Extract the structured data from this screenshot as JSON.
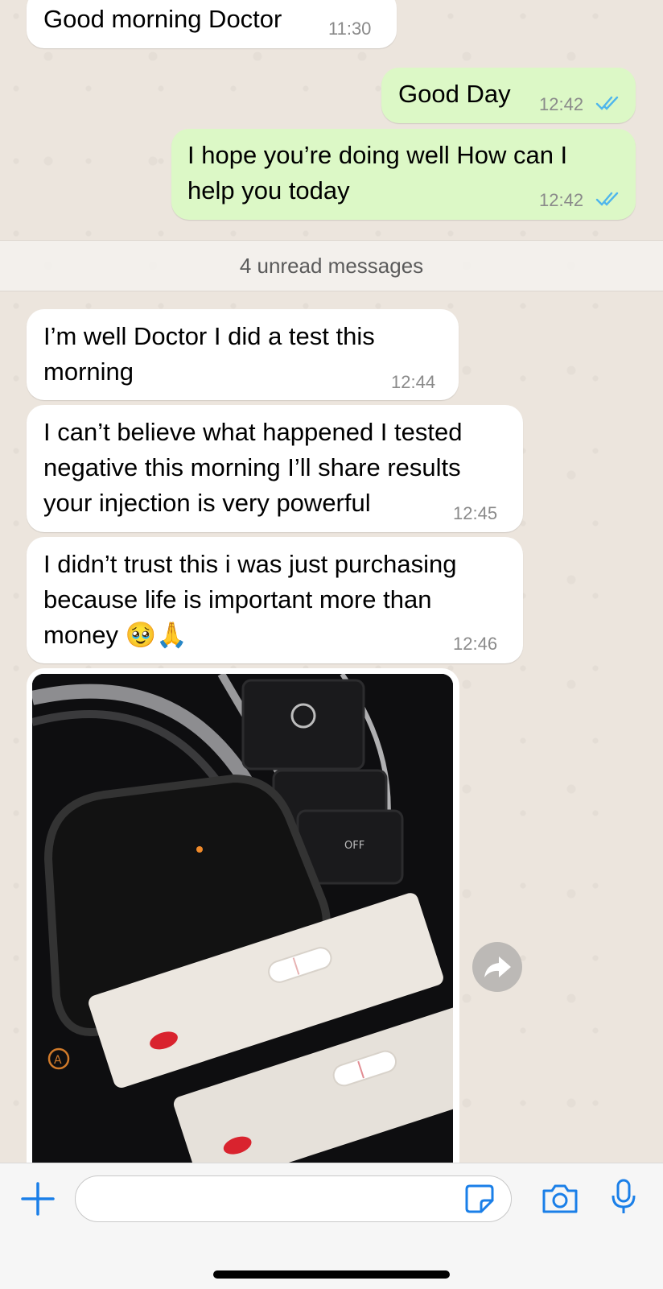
{
  "messages": [
    {
      "text": "Good morning Doctor",
      "time": "11:30",
      "direction": "incoming"
    },
    {
      "text": "Good Day",
      "time": "12:42",
      "direction": "outgoing",
      "status": "read"
    },
    {
      "text_lines": [
        "I hope you’re doing well How can I",
        "help you today"
      ],
      "time": "12:42",
      "direction": "outgoing",
      "status": "read"
    },
    {
      "text_lines": [
        "I’m well Doctor I did a test this",
        "morning"
      ],
      "time": "12:44",
      "direction": "incoming"
    },
    {
      "text_lines": [
        "I can’t believe what happened I tested",
        "negative this morning I’ll share results",
        "your injection is very powerful"
      ],
      "time": "12:45",
      "direction": "incoming"
    },
    {
      "text_lines": [
        "I didn’t trust this i was just purchasing",
        "because life is important more than",
        "money 🥹🙏"
      ],
      "time": "12:46",
      "direction": "incoming"
    }
  ],
  "unread_separator": "4 unread messages",
  "image_message": {
    "direction": "incoming",
    "icon": "photo-of-test-strips"
  },
  "composer": {
    "placeholder": ""
  },
  "icons": [
    "plus-icon",
    "sticker-icon",
    "camera-icon",
    "microphone-icon",
    "forward-icon",
    "read-receipt-icon"
  ],
  "colors": {
    "incoming_bubble": "#ffffff",
    "outgoing_bubble": "#dcf8c6",
    "read_tick": "#4fb6ec",
    "accent": "#1a7fe8"
  }
}
